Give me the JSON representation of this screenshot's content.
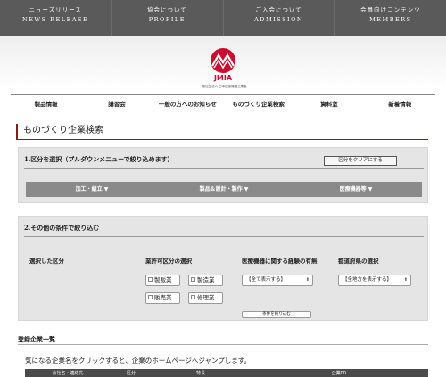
{
  "top_nav": [
    {
      "jp": "ニューズリリース",
      "en": "NEWS RELEASE"
    },
    {
      "jp": "協会について",
      "en": "PROFILE"
    },
    {
      "jp": "ご入会について",
      "en": "ADMISSION"
    },
    {
      "jp": "会員向けコンテンツ",
      "en": "MEMBERS"
    }
  ],
  "logo": {
    "text": "JMIA",
    "sub": "一般社団法人 日本医療機器工業会",
    "color": "#c8102e"
  },
  "main_nav": [
    "製品情報",
    "講習会",
    "一般の方へのお知らせ",
    "ものづくり企業検索",
    "資料室",
    "新着情報"
  ],
  "page_title": "ものづくり企業検索",
  "section1": {
    "heading": "1.区分を選択（プルダウンメニューで絞り込めます）",
    "clear_button": "区分をクリアにする",
    "categories": [
      "加工・組立 ▼",
      "製品＆設計・製作 ▼",
      "医療機器等 ▼"
    ]
  },
  "section2": {
    "heading": "2.その他の条件で絞り込む",
    "col_selected": "選択した区分",
    "col_license": "業許可区分の選択",
    "col_experience": "医療機器に関する経験の有無",
    "col_prefecture": "都道府県の選択",
    "license_options": [
      "製販業",
      "製造業",
      "販売業",
      "修理業"
    ],
    "experience_select": "【全て表示する】",
    "prefecture_select": "【全地方を表示する】",
    "search_button": "条件を絞り込む"
  },
  "list": {
    "title": "登録企業一覧",
    "description": "気になる企業名をクリックすると、企業のホームページへジャンプします。",
    "columns": [
      "会社名・連絡先",
      "区分",
      "特長",
      "企業PR"
    ]
  },
  "colors": {
    "accent": "#8b1a1a",
    "topnav": "#5a5a5a",
    "panel": "#e5e5e5",
    "catbar": "#8a8a8a"
  }
}
